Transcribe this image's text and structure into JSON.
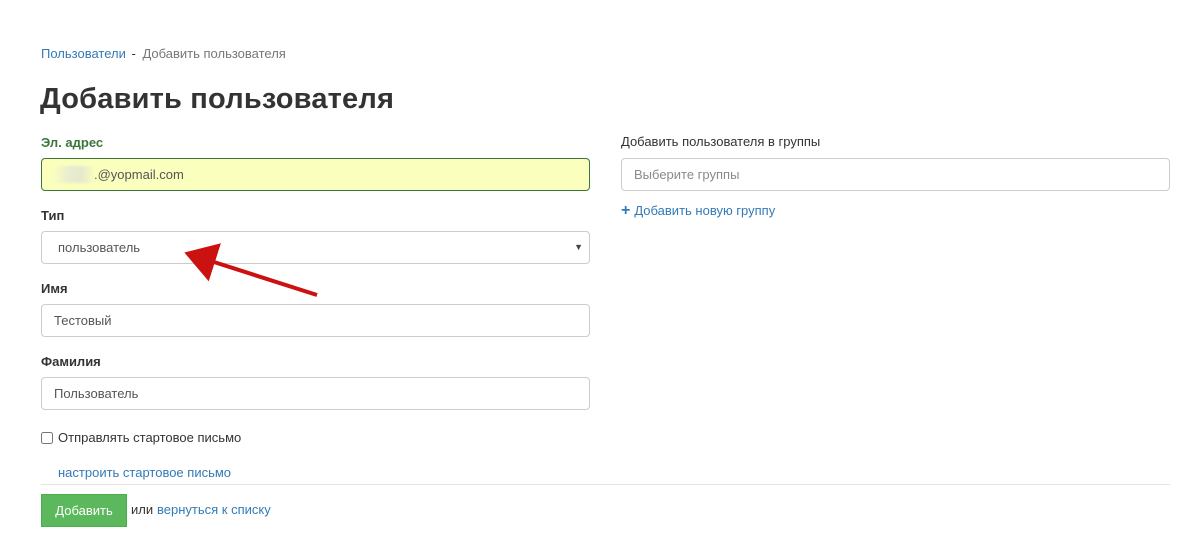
{
  "breadcrumb": {
    "parent": "Пользователи",
    "separator": "-",
    "current": "Добавить пользователя"
  },
  "page_title": "Добавить пользователя",
  "form": {
    "email": {
      "label": "Эл. адрес",
      "value": ".@yopmail.com"
    },
    "type": {
      "label": "Тип",
      "selected": "пользователь"
    },
    "first_name": {
      "label": "Имя",
      "value": "Тестовый"
    },
    "last_name": {
      "label": "Фамилия",
      "value": "Пользователь"
    },
    "send_welcome": {
      "label": "Отправлять стартовое письмо",
      "checked": false
    },
    "configure_link": "настроить стартовое письмо",
    "submit_label": "Добавить",
    "or_text": "или",
    "back_link": "вернуться к списку"
  },
  "groups": {
    "label": "Добавить пользователя в группы",
    "placeholder": "Выберите группы",
    "add_group_link": "Добавить новую группу",
    "add_icon": "plus-icon"
  },
  "colors": {
    "link": "#337ab7",
    "success_label": "#3c763d",
    "autofill_bg": "#faffbd",
    "button": "#5cb85c",
    "annotation_arrow": "#cc1111"
  }
}
